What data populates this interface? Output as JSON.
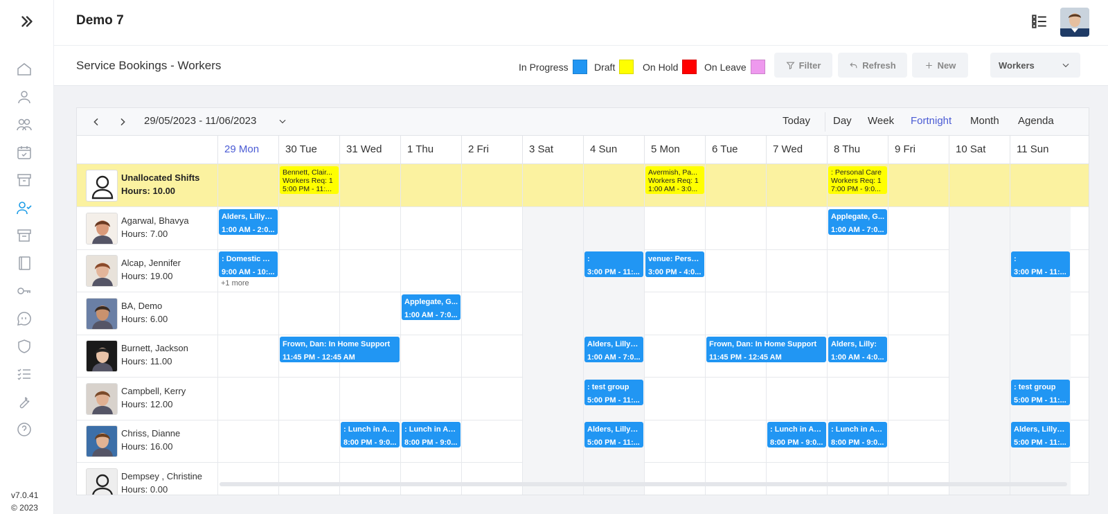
{
  "app": {
    "title": "Demo 7",
    "version": "v7.0.41",
    "copyright": "© 2023"
  },
  "sidebar": {
    "items": [
      {
        "name": "home-icon"
      },
      {
        "name": "user-icon"
      },
      {
        "name": "users-icon"
      },
      {
        "name": "calendar-check-icon"
      },
      {
        "name": "archive-icon"
      },
      {
        "name": "user-check-icon",
        "active": true
      },
      {
        "name": "box-icon"
      },
      {
        "name": "notebook-icon"
      },
      {
        "name": "key-icon"
      },
      {
        "name": "chat-icon"
      },
      {
        "name": "shield-icon"
      },
      {
        "name": "list-check-icon"
      },
      {
        "name": "wrench-icon"
      },
      {
        "name": "help-icon"
      }
    ]
  },
  "subheader": {
    "title": "Service Bookings - Workers",
    "legend": [
      {
        "label": "In Progress",
        "color": "#2196f3"
      },
      {
        "label": "Draft",
        "color": "#ffff00"
      },
      {
        "label": "On Hold",
        "color": "#ff0000"
      },
      {
        "label": "On Leave",
        "color": "#ee99ee"
      }
    ],
    "buttons": {
      "filter": "Filter",
      "refresh": "Refresh",
      "new": "New"
    },
    "view_select": "Workers"
  },
  "calendar": {
    "range": "29/05/2023 - 11/06/2023",
    "views": {
      "today": "Today",
      "day": "Day",
      "week": "Week",
      "fortnight": "Fortnight",
      "month": "Month",
      "agenda": "Agenda"
    },
    "active_view": "Fortnight",
    "days": [
      "29 Mon",
      "30 Tue",
      "31 Wed",
      "1 Thu",
      "2 Fri",
      "3 Sat",
      "4 Sun",
      "5 Mon",
      "6 Tue",
      "7 Wed",
      "8 Thu",
      "9 Fri",
      "10 Sat",
      "11 Sun"
    ],
    "resources": [
      {
        "name": "Unallocated Shifts",
        "hours": "Hours: 10.00"
      },
      {
        "name": "Agarwal, Bhavya",
        "hours": "Hours: 7.00"
      },
      {
        "name": "Alcap, Jennifer",
        "hours": "Hours: 19.00"
      },
      {
        "name": "BA, Demo",
        "hours": "Hours: 6.00"
      },
      {
        "name": "Burnett, Jackson",
        "hours": "Hours: 11.00"
      },
      {
        "name": "Campbell, Kerry",
        "hours": "Hours: 12.00"
      },
      {
        "name": "Chriss, Dianne",
        "hours": "Hours: 16.00"
      },
      {
        "name": "Dempsey , Christine",
        "hours": "Hours: 0.00"
      }
    ],
    "more_link": "+1 more",
    "events": [
      {
        "row": 0,
        "day": 1,
        "span": 1,
        "status": "draft",
        "lines": [
          "Bennett, Clair...",
          "Workers Req: 1",
          "5:00 PM - 11:..."
        ]
      },
      {
        "row": 0,
        "day": 7,
        "span": 1,
        "status": "draft",
        "lines": [
          "Avermish, Pa...",
          "Workers Req: 1",
          "1:00 AM - 3:0..."
        ]
      },
      {
        "row": 0,
        "day": 10,
        "span": 1,
        "status": "draft",
        "lines": [
          ": Personal Care",
          "Workers Req: 1",
          "7:00 PM - 9:0..."
        ]
      },
      {
        "row": 1,
        "day": 0,
        "span": 1,
        "status": "progress",
        "lines": [
          "Alders, Lilly: ...",
          "1:00 AM - 2:0..."
        ]
      },
      {
        "row": 1,
        "day": 10,
        "span": 1,
        "status": "progress",
        "lines": [
          "Applegate, G...",
          "1:00 AM - 7:0..."
        ]
      },
      {
        "row": 2,
        "day": 0,
        "span": 1,
        "status": "progress",
        "lines": [
          ": Domestic As...",
          "9:00 AM - 10:..."
        ]
      },
      {
        "row": 2,
        "day": 6,
        "span": 1,
        "status": "progress",
        "lines": [
          ":",
          "3:00 PM - 11:..."
        ]
      },
      {
        "row": 2,
        "day": 7,
        "span": 1,
        "status": "progress",
        "lines": [
          "venue: Perso...",
          "3:00 PM - 4:0..."
        ]
      },
      {
        "row": 2,
        "day": 13,
        "span": 1,
        "status": "progress",
        "lines": [
          ":",
          "3:00 PM - 11:..."
        ]
      },
      {
        "row": 3,
        "day": 3,
        "span": 1,
        "status": "progress",
        "lines": [
          "Applegate, G...",
          "1:00 AM - 7:0..."
        ]
      },
      {
        "row": 4,
        "day": 1,
        "span": 2,
        "status": "progress",
        "lines": [
          "Frown, Dan: In Home Support",
          "11:45 PM - 12:45 AM"
        ]
      },
      {
        "row": 4,
        "day": 6,
        "span": 1,
        "status": "progress",
        "lines": [
          "Alders, Lilly: ...",
          "1:00 AM - 7:0..."
        ]
      },
      {
        "row": 4,
        "day": 8,
        "span": 2,
        "status": "progress",
        "lines": [
          "Frown, Dan: In Home Support",
          "11:45 PM - 12:45 AM"
        ]
      },
      {
        "row": 4,
        "day": 10,
        "span": 1,
        "status": "progress",
        "lines": [
          "Alders, Lilly:",
          "1:00 AM - 4:0..."
        ]
      },
      {
        "row": 5,
        "day": 6,
        "span": 1,
        "status": "progress",
        "lines": [
          ": test group",
          "5:00 PM - 11:..."
        ]
      },
      {
        "row": 5,
        "day": 13,
        "span": 1,
        "status": "progress",
        "lines": [
          ": test group",
          "5:00 PM - 11:..."
        ]
      },
      {
        "row": 6,
        "day": 2,
        "span": 1,
        "status": "progress",
        "lines": [
          ": Lunch in Art...",
          "8:00 PM - 9:0..."
        ]
      },
      {
        "row": 6,
        "day": 3,
        "span": 1,
        "status": "progress",
        "lines": [
          ": Lunch in Art...",
          "8:00 PM - 9:0..."
        ]
      },
      {
        "row": 6,
        "day": 6,
        "span": 1,
        "status": "progress",
        "lines": [
          "Alders, Lilly: t...",
          "5:00 PM - 11:..."
        ]
      },
      {
        "row": 6,
        "day": 9,
        "span": 1,
        "status": "progress",
        "lines": [
          ": Lunch in Art...",
          "8:00 PM - 9:0..."
        ]
      },
      {
        "row": 6,
        "day": 10,
        "span": 1,
        "status": "progress",
        "lines": [
          ": Lunch in Art...",
          "8:00 PM - 9:0..."
        ]
      },
      {
        "row": 6,
        "day": 13,
        "span": 1,
        "status": "progress",
        "lines": [
          "Alders, Lilly: t...",
          "5:00 PM - 11:..."
        ]
      }
    ]
  }
}
